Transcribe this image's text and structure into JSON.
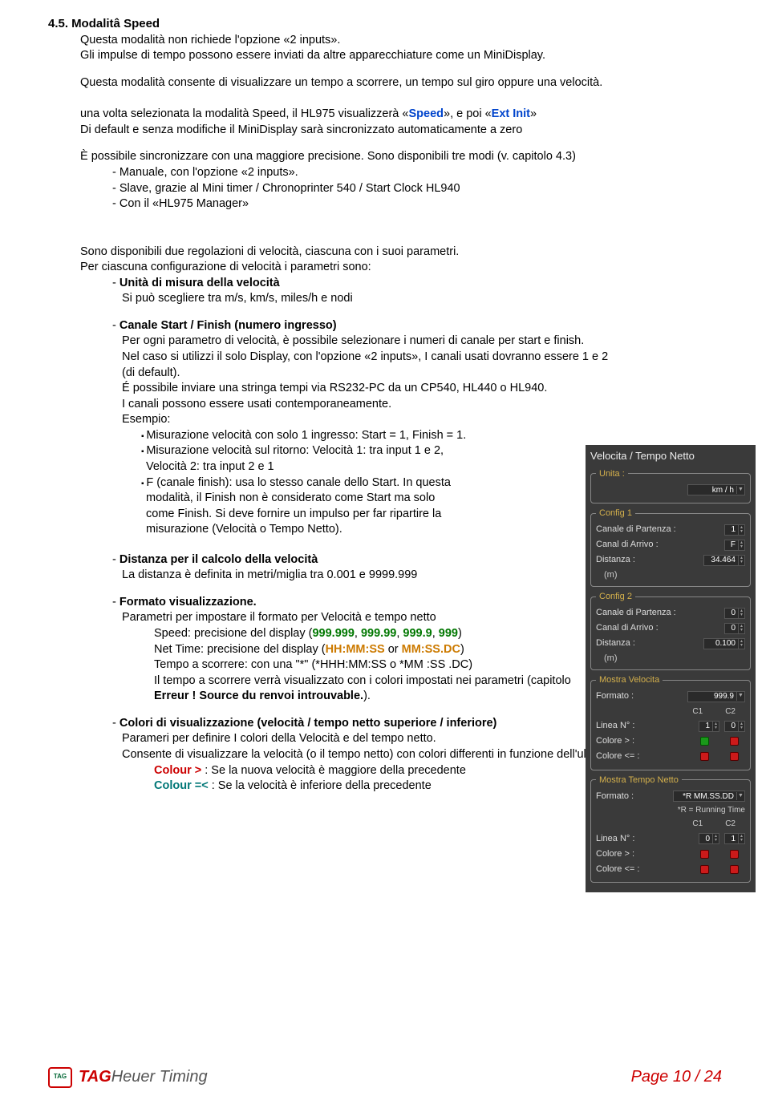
{
  "section": {
    "number": "4.5.",
    "title": "Modalitâ Speed",
    "p1": "Questa modalità non richiede l'opzione «2 inputs».",
    "p2": "Gli impulse di tempo possono essere inviati da altre apparecchiature come un MiniDisplay.",
    "p3": "Questa modalità consente di visualizzare un tempo a scorrere, un tempo sul giro oppure una velocità.",
    "p4a": "una volta selezionata la modalità Speed, il HL975 visualizzerà «",
    "p4b": "Speed",
    "p4c": "», e poi «",
    "p4d": "Ext Init",
    "p4e": "»",
    "p5": "Di default e senza modifiche il MiniDisplay sarà sincronizzato automaticamente a zero",
    "p6": "È possibile sincronizzare con una maggiore precisione. Sono disponibili tre modi (v. capitolo 4.3)",
    "modes": {
      "m1": "Manuale, con l'opzione «2 inputs».",
      "m2": "Slave, grazie al Mini timer / Chronoprinter 540 / Start Clock HL940",
      "m3": "Con il «HL975 Manager»"
    },
    "p7": "Sono disponibili due regolazioni di velocità, ciascuna con i suoi parametri.",
    "p8": "Per ciascuna configurazione di velocità i parametri sono:",
    "params": {
      "unit": {
        "title": "Unità di misura della velocità",
        "desc": "Si può scegliere tra m/s, km/s, miles/h e nodi"
      },
      "channel": {
        "title": "Canale Start / Finish (numero ingresso)",
        "l1": "Per ogni parametro di velocità, è possibile selezionare i numeri di canale per start e finish.",
        "l2": "Nel caso si utilizzi il solo Display, con l'opzione «2 inputs», I canali usati dovranno essere 1 e 2 (di default).",
        "l3": "É possibile inviare una stringa tempi via RS232-PC da un CP540, HL440 o HL940.",
        "l4": "I canali possono essere usati contemporaneamente.",
        "l5": "Esempio:",
        "b1": "Misurazione velocità con solo 1 ingresso: Start = 1, Finish = 1.",
        "b2a": "Misurazione velocità sul ritorno: Velocità 1: tra input 1 e 2,",
        "b2b": "Velocità 2: tra input 2 e 1",
        "b3a": "F (canale finish): usa lo stesso canale dello Start. In questa",
        "b3b": "modalità, il Finish non è considerato come Start ma solo",
        "b3c": "come Finish. Si deve fornire un impulso per far ripartire la",
        "b3d": "misurazione (Velocità o Tempo Netto)."
      },
      "distance": {
        "title": "Distanza per il calcolo della velocità",
        "desc": "La distanza è definita in metri/miglia tra 0.001 e 9999.999"
      },
      "format": {
        "title": "Formato visualizzazione.",
        "l1": "Parametri per impostare il formato per Velocità e tempo netto",
        "l2a": "Speed: precisione del display  (",
        "l2v1": "999.999",
        "l2c": ", ",
        "l2v2": "999.99",
        "l2v3": "999.9",
        "l2v4": "999",
        "l2e": ")",
        "l3a": "Net Time: precisione del display (",
        "l3v1": "HH:MM:SS",
        "l3or": " or ",
        "l3v2": "MM:SS.DC",
        "l3e": ")",
        "l4": "Tempo a scorrere: con una \"*\" (*HHH:MM:SS o *MM :SS .DC)",
        "l5": "Il tempo a scorrere verrà visualizzato con i colori impostati nei parametri (capitolo",
        "l6": "Erreur ! Source du renvoi introuvable.",
        "l6b": ")."
      },
      "colors": {
        "title": "Colori di visualizzazione (velocità / tempo netto superiore / inferiore)",
        "l1": "Parameri per definire I colori della Velocità e del tempo netto.",
        "l2": "Consente di visualizzare la velocità (o il tempo netto) con colori differenti in funzione dell'ultimo valore.",
        "c1a": "Colour >",
        "c1b": " : Se la nuova velocità è maggiore della precedente",
        "c2a": "Colour =<",
        "c2b": " : Se la velocità è inferiore della precedente"
      }
    }
  },
  "panel": {
    "title": "Velocita / Tempo Netto",
    "unita_group": "Unita :",
    "unita": "km / h",
    "config1": "Config 1",
    "config2": "Config 2",
    "partenza": "Canale di Partenza :",
    "arrivo": "Canal di Arrivo :",
    "distanza": "Distanza :",
    "m": "(m)",
    "c1": {
      "partenza": "1",
      "arrivo": "F",
      "dist": "34.464"
    },
    "c2": {
      "partenza": "0",
      "arrivo": "0",
      "dist": "0.100"
    },
    "mostra_vel": "Mostra Velocita",
    "formato": "Formato :",
    "formato_val": "999.9",
    "c1h": "C1",
    "c2h": "C2",
    "linea": "Linea N° :",
    "linea1": "1",
    "linea2": "0",
    "colore_gt": "Colore > :",
    "colore_le": "Colore <= :",
    "mostra_net": "Mostra Tempo Netto",
    "fmt2": "*R MM.SS.DD",
    "rnote": "*R = Running Time",
    "net_l1": "0",
    "net_l2": "1"
  },
  "footer": {
    "tag": "TAG",
    "heuer": "Heuer Timing",
    "page": "Page 10 / 24"
  }
}
